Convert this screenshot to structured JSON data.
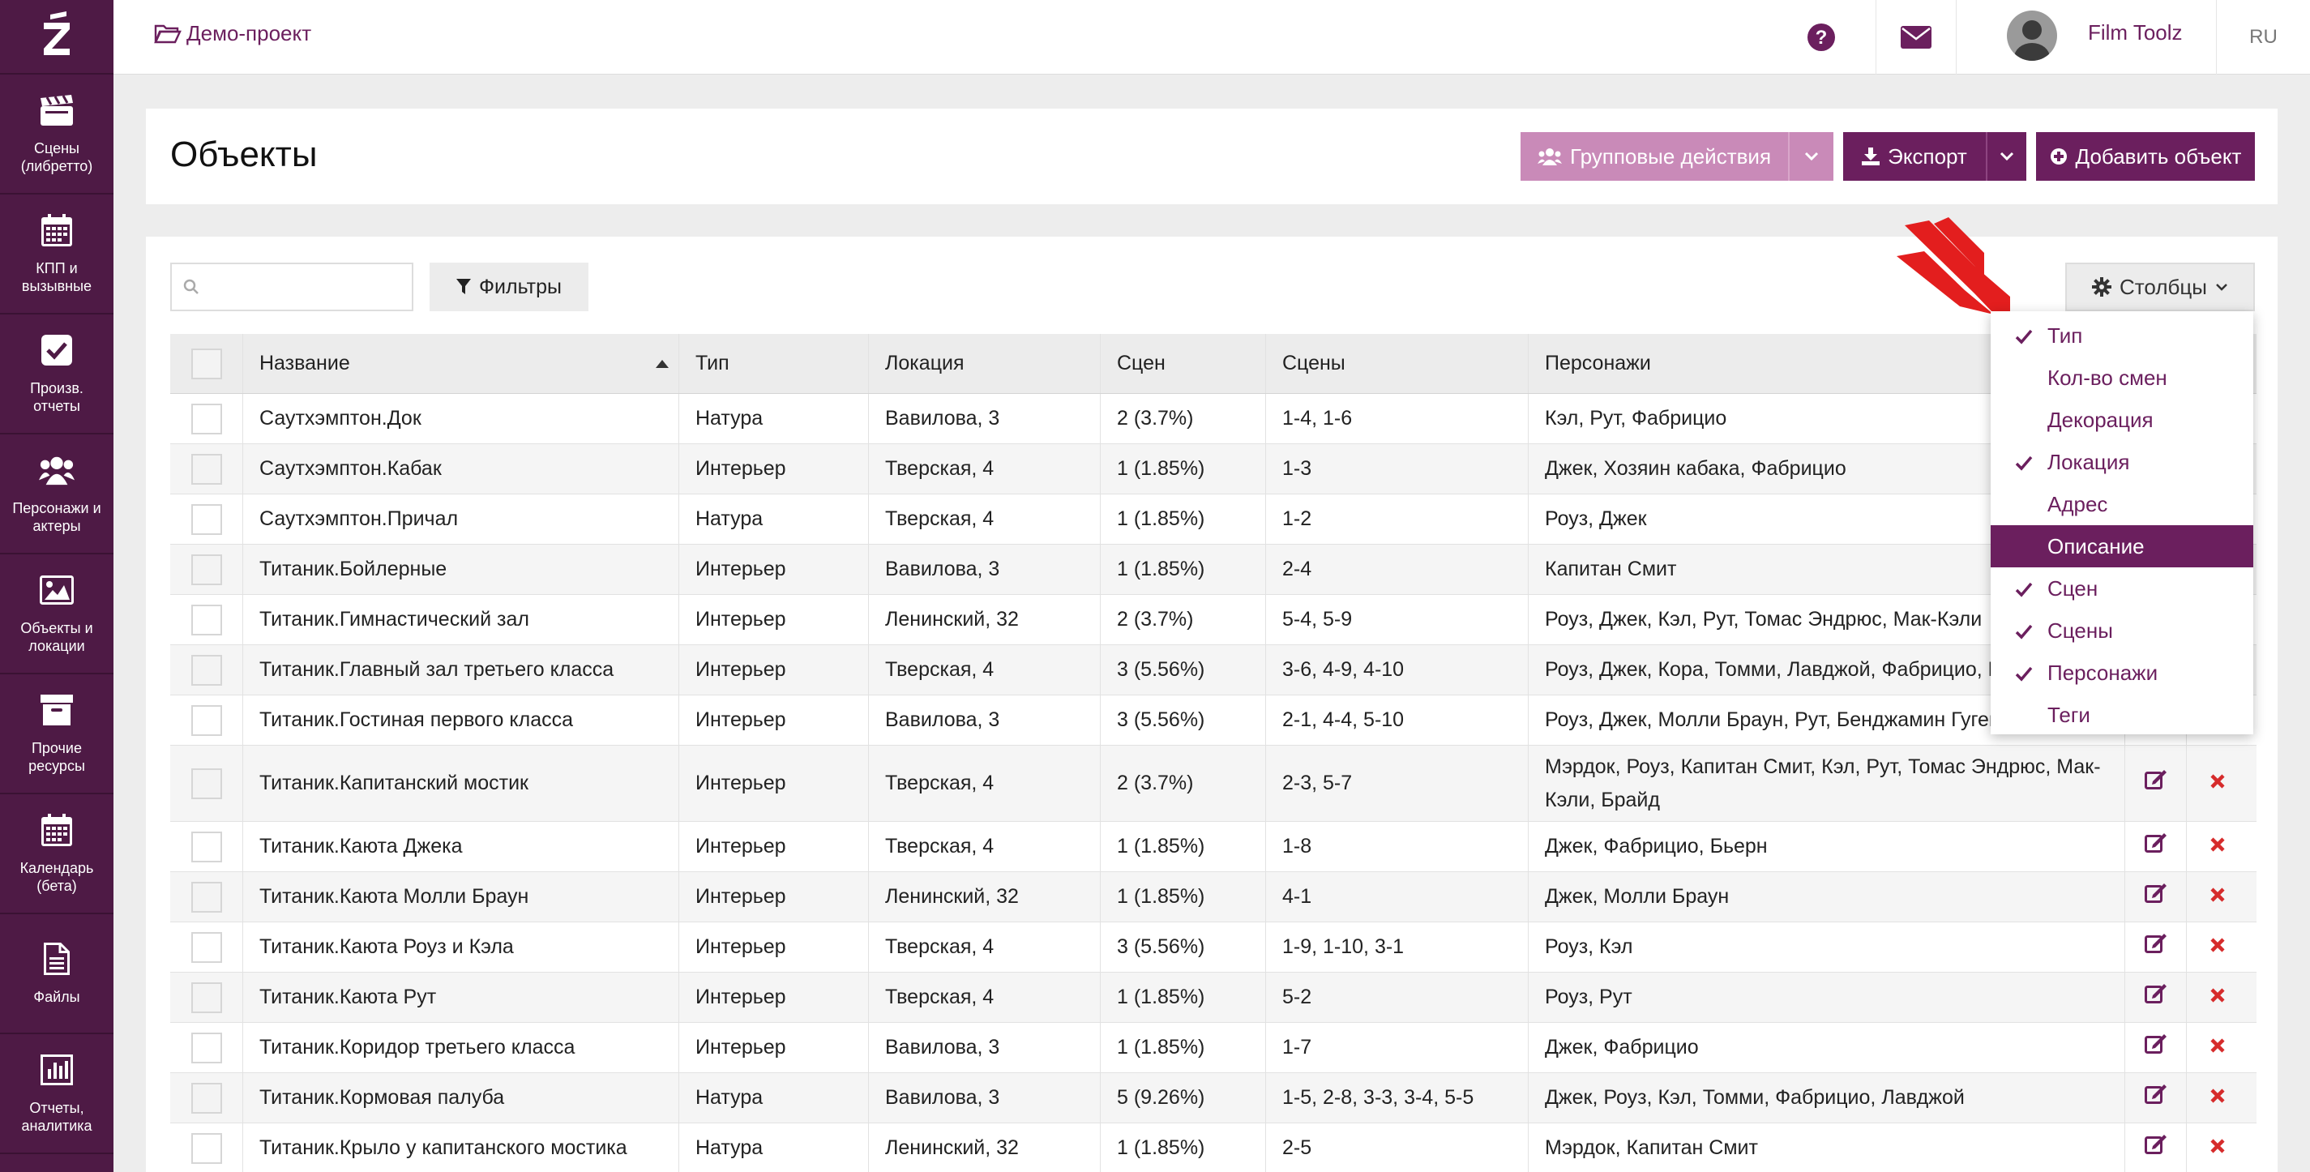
{
  "sidebar": {
    "logo_icon": "z-logo-icon",
    "items": [
      {
        "label": "Сцены (либретто)",
        "icon": "clapperboard-icon"
      },
      {
        "label": "КПП и вызывные",
        "icon": "calendar-icon"
      },
      {
        "label": "Произв. отчеты",
        "icon": "check-square-icon"
      },
      {
        "label": "Персонажи и актеры",
        "icon": "users-icon"
      },
      {
        "label": "Объекты и локации",
        "icon": "image-icon"
      },
      {
        "label": "Прочие ресурсы",
        "icon": "archive-icon"
      },
      {
        "label": "Календарь (бета)",
        "icon": "calendar-icon"
      },
      {
        "label": "Файлы",
        "icon": "file-icon"
      },
      {
        "label": "Отчеты, аналитика",
        "icon": "bar-chart-icon"
      }
    ]
  },
  "topbar": {
    "project": "Демо-проект",
    "user_name": "Film Toolz",
    "lang": "RU"
  },
  "header": {
    "title": "Объекты",
    "group_actions": "Групповые действия",
    "export": "Экспорт",
    "add_object": "Добавить объект"
  },
  "toolbar": {
    "search_placeholder": "",
    "filters": "Фильтры",
    "columns": "Столбцы"
  },
  "table": {
    "headers": [
      "Название",
      "Тип",
      "Локация",
      "Сцен",
      "Сцены",
      "Персонажи"
    ],
    "rows": [
      {
        "name": "Саутхэмптон.Док",
        "type": "Натура",
        "location": "Вавилова, 3",
        "count": "2 (3.7%)",
        "scenes": "1-4, 1-6",
        "characters": "Кэл, Рут, Фабрицио"
      },
      {
        "name": "Саутхэмптон.Кабак",
        "type": "Интерьер",
        "location": "Тверская, 4",
        "count": "1 (1.85%)",
        "scenes": "1-3",
        "characters": "Джек, Хозяин кабака, Фабрицио"
      },
      {
        "name": "Саутхэмптон.Причал",
        "type": "Натура",
        "location": "Тверская, 4",
        "count": "1 (1.85%)",
        "scenes": "1-2",
        "characters": "Роуз, Джек"
      },
      {
        "name": "Титаник.Бойлерные",
        "type": "Интерьер",
        "location": "Вавилова, 3",
        "count": "1 (1.85%)",
        "scenes": "2-4",
        "characters": "Капитан Смит"
      },
      {
        "name": "Титаник.Гимнастический зал",
        "type": "Интерьер",
        "location": "Ленинский, 32",
        "count": "2 (3.7%)",
        "scenes": "5-4, 5-9",
        "characters": "Роуз, Джек, Кэл, Рут, Томас Эндрюс, Мак-Кэли"
      },
      {
        "name": "Титаник.Главный зал третьего класса",
        "type": "Интерьер",
        "location": "Тверская, 4",
        "count": "3 (5.56%)",
        "scenes": "3-6, 4-9, 4-10",
        "characters": "Роуз, Джек, Кора, Томми, Лавджой, Фабрицио, Бі"
      },
      {
        "name": "Титаник.Гостиная первого класса",
        "type": "Интерьер",
        "location": "Вавилова, 3",
        "count": "3 (5.56%)",
        "scenes": "2-1, 4-4, 5-10",
        "characters": "Роуз, Джек, Молли Браун, Рут, Бенджамин Гугенх"
      },
      {
        "name": "Титаник.Капитанский мостик",
        "type": "Интерьер",
        "location": "Тверская, 4",
        "count": "2 (3.7%)",
        "scenes": "2-3, 5-7",
        "characters": "Мэрдок, Роуз, Капитан Смит, Кэл, Рут, Томас Эндрюс, Мак-Кэли, Брайд"
      },
      {
        "name": "Титаник.Каюта Джека",
        "type": "Интерьер",
        "location": "Тверская, 4",
        "count": "1 (1.85%)",
        "scenes": "1-8",
        "characters": "Джек, Фабрицио, Бьерн"
      },
      {
        "name": "Титаник.Каюта Молли Браун",
        "type": "Интерьер",
        "location": "Ленинский, 32",
        "count": "1 (1.85%)",
        "scenes": "4-1",
        "characters": "Джек, Молли Браун"
      },
      {
        "name": "Титаник.Каюта Роуз и Кэла",
        "type": "Интерьер",
        "location": "Тверская, 4",
        "count": "3 (5.56%)",
        "scenes": "1-9, 1-10, 3-1",
        "characters": "Роуз, Кэл"
      },
      {
        "name": "Титаник.Каюта Рут",
        "type": "Интерьер",
        "location": "Тверская, 4",
        "count": "1 (1.85%)",
        "scenes": "5-2",
        "characters": "Роуз, Рут"
      },
      {
        "name": "Титаник.Коридор третьего класса",
        "type": "Интерьер",
        "location": "Вавилова, 3",
        "count": "1 (1.85%)",
        "scenes": "1-7",
        "characters": "Джек, Фабрицио"
      },
      {
        "name": "Титаник.Кормовая палуба",
        "type": "Натура",
        "location": "Вавилова, 3",
        "count": "5 (9.26%)",
        "scenes": "1-5, 2-8, 3-3, 3-4, 5-5",
        "characters": "Джек, Роуз, Кэл, Томми, Фабрицио, Лавджой"
      },
      {
        "name": "Титаник.Крыло у капитанского мостика",
        "type": "Натура",
        "location": "Ленинский, 32",
        "count": "1 (1.85%)",
        "scenes": "2-5",
        "characters": "Мэрдок, Капитан Смит"
      }
    ]
  },
  "columns_menu": {
    "items": [
      {
        "label": "Тип",
        "checked": true,
        "active": false
      },
      {
        "label": "Кол-во смен",
        "checked": false,
        "active": false
      },
      {
        "label": "Декорация",
        "checked": false,
        "active": false
      },
      {
        "label": "Локация",
        "checked": true,
        "active": false
      },
      {
        "label": "Адрес",
        "checked": false,
        "active": false
      },
      {
        "label": "Описание",
        "checked": false,
        "active": true
      },
      {
        "label": "Сцен",
        "checked": true,
        "active": false
      },
      {
        "label": "Сцены",
        "checked": true,
        "active": false
      },
      {
        "label": "Персонажи",
        "checked": true,
        "active": false
      },
      {
        "label": "Теги",
        "checked": false,
        "active": false
      }
    ]
  },
  "colors": {
    "brand": "#6b1f5e",
    "sidebar": "#4e1a45",
    "delete": "#d62b2b",
    "arrow": "#e31e1e"
  }
}
